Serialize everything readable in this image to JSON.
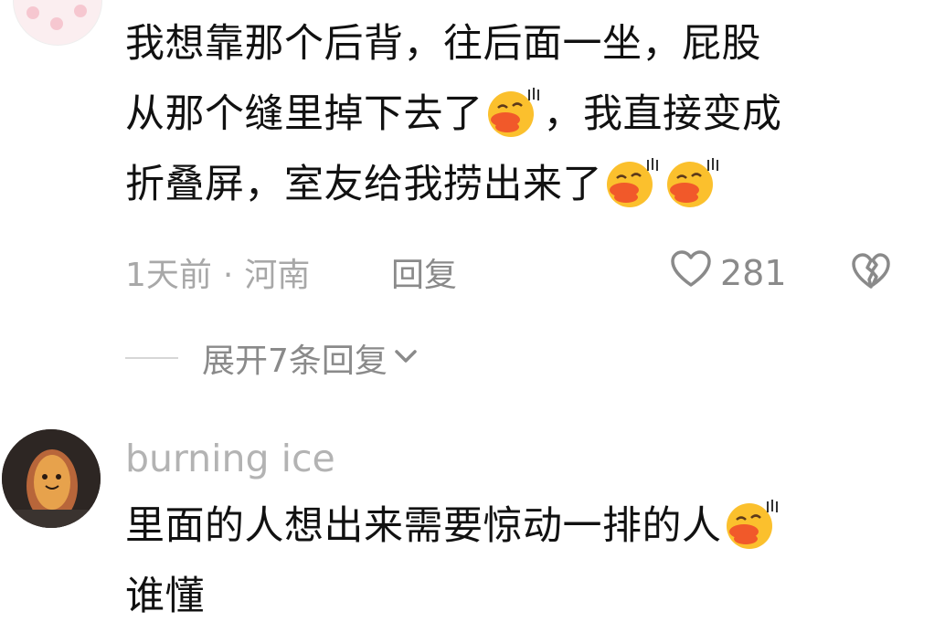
{
  "comment1": {
    "lines": [
      "我想靠那个后背，往后面一坐，屁股",
      "从那个缝里掉下去了",
      "，我直接变成",
      "折叠屏，室友给我捞出来了"
    ],
    "emoji": "grinning-squint-emoji",
    "time": "1天前",
    "separator": "·",
    "location": "河南",
    "reply_label": "回复",
    "like_count": "281",
    "expand_label": "展开7条回复"
  },
  "comment2": {
    "username": "burning ice",
    "lines": [
      "里面的人想出来需要惊动一排的人",
      "谁懂"
    ]
  },
  "colors": {
    "text": "#111111",
    "meta": "#a8a8a8",
    "action": "#8a8a8a",
    "emoji": "#fbc02d",
    "lips": "#f1592a"
  }
}
